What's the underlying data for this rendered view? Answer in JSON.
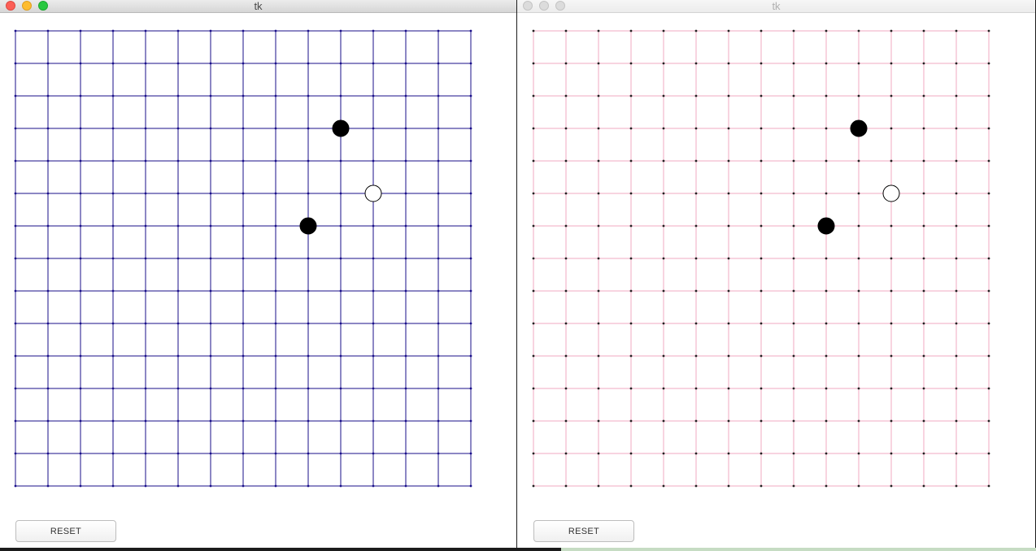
{
  "windows": [
    {
      "title": "tk",
      "active": true,
      "reset_label": "RESET",
      "grid_color": "#1a0f8a",
      "dot_color": "#1a0f8a"
    },
    {
      "title": "tk",
      "active": false,
      "reset_label": "RESET",
      "grid_color": "#f0a8c0",
      "dot_color": "#222222"
    }
  ],
  "board": {
    "size": 15,
    "stones": [
      {
        "col": 10,
        "row": 3,
        "color": "black"
      },
      {
        "col": 11,
        "row": 5,
        "color": "white"
      },
      {
        "col": 9,
        "row": 6,
        "color": "black"
      }
    ]
  }
}
